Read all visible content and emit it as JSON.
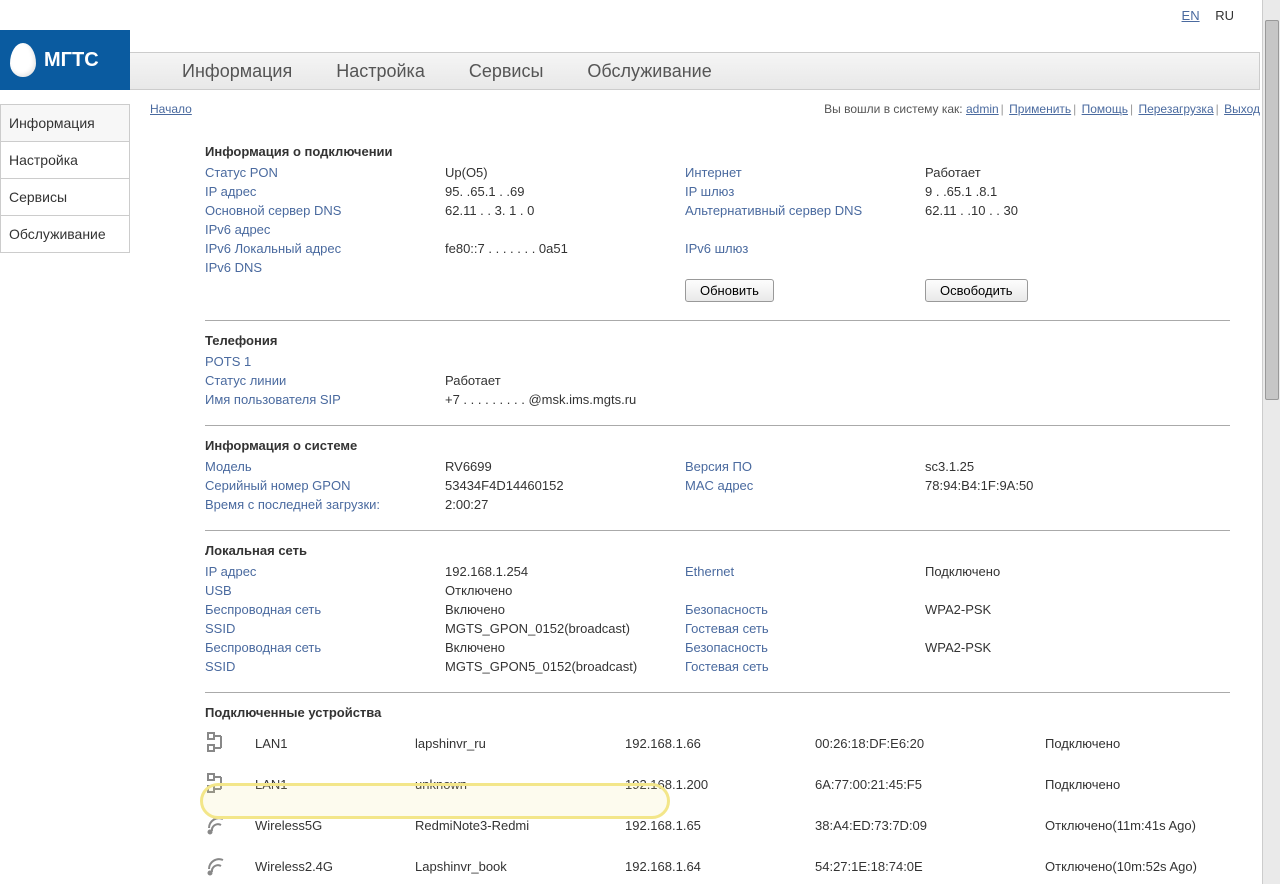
{
  "lang": {
    "en": "EN",
    "ru": "RU"
  },
  "logo": "МГТС",
  "topnav": [
    "Информация",
    "Настройка",
    "Сервисы",
    "Обслуживание"
  ],
  "sidenav": [
    "Информация",
    "Настройка",
    "Сервисы",
    "Обслуживание"
  ],
  "breadcrumb": "Начало",
  "login_prefix": "Вы вошли в систему как: ",
  "login_links": [
    "admin",
    "Применить",
    "Помощь",
    "Перезагрузка",
    "Выход"
  ],
  "section_connection": "Информация о подключении",
  "conn": {
    "pon_status_l": "Статус PON",
    "pon_status_v": "Up(O5)",
    "internet_l": "Интернет",
    "internet_v": "Работает",
    "ip_l": "IP адрес",
    "ip_v": "95. .65.1 . .69",
    "gw_l": "IP шлюз",
    "gw_v": "9 . .65.1 .8.1",
    "dns1_l": "Основной сервер DNS",
    "dns1_v": "62.11 . . 3. 1 . 0",
    "dns2_l": "Альтернативный сервер DNS",
    "dns2_v": "62.11 . .10 . . 30",
    "ipv6_l": "IPv6 адрес",
    "ipv6ll_l": "IPv6 Локальный адрес",
    "ipv6ll_v": "fe80::7 . . . . . . . 0a51",
    "ipv6gw_l": "IPv6 шлюз",
    "ipv6dns_l": "IPv6 DNS",
    "btn_refresh": "Обновить",
    "btn_release": "Освободить"
  },
  "section_phone": "Телефония",
  "phone": {
    "pots_l": "POTS 1",
    "line_l": "Статус линии",
    "line_v": "Работает",
    "sip_l": "Имя пользователя SIP",
    "sip_v": "+7 . . . . . . . . . @msk.ims.mgts.ru"
  },
  "section_sys": "Информация о системе",
  "sys": {
    "model_l": "Модель",
    "model_v": "RV6699",
    "fw_l": "Версия ПО",
    "fw_v": "sc3.1.25",
    "sn_l": "Серийный номер GPON",
    "sn_v": "53434F4D14460152",
    "mac_l": "MAC адрес",
    "mac_v": "78:94:B4:1F:9A:50",
    "uptime_l": "Время с последней загрузки:",
    "uptime_v": "2:00:27"
  },
  "section_lan": "Локальная сеть",
  "lan": {
    "ip_l": "IP адрес",
    "ip_v": "192.168.1.254",
    "eth_l": "Ethernet",
    "eth_v": "Подключено",
    "usb_l": "USB",
    "usb_v": "Отключено",
    "wl1_l": "Беспроводная сеть",
    "wl1_v": "Включено",
    "sec1_l": "Безопасность",
    "sec1_v": "WPA2-PSK",
    "ssid1_l": "SSID",
    "ssid1_v": "MGTS_GPON_0152(broadcast)",
    "guest1_l": "Гостевая сеть",
    "wl2_l": "Беспроводная сеть",
    "wl2_v": "Включено",
    "sec2_l": "Безопасность",
    "sec2_v": "WPA2-PSK",
    "ssid2_l": "SSID",
    "ssid2_v": "MGTS_GPON5_0152(broadcast)",
    "guest2_l": "Гостевая сеть"
  },
  "section_dev": "Подключенные устройства",
  "devices": [
    {
      "icon": "lan",
      "iface": "LAN1",
      "name": "lapshinvr_ru",
      "ip": "192.168.1.66",
      "mac": "00:26:18:DF:E6:20",
      "status": "Подключено"
    },
    {
      "icon": "lan",
      "iface": "LAN1",
      "name": "unknown",
      "ip": "192.168.1.200",
      "mac": "6A:77:00:21:45:F5",
      "status": "Подключено"
    },
    {
      "icon": "wifi",
      "iface": "Wireless5G",
      "name": "RedmiNote3-Redmi",
      "ip": "192.168.1.65",
      "mac": "38:A4:ED:73:7D:09",
      "status": "Отключено(11m:41s Ago)"
    },
    {
      "icon": "wifi",
      "iface": "Wireless2.4G",
      "name": "Lapshinvr_book",
      "ip": "192.168.1.64",
      "mac": "54:27:1E:18:74:0E",
      "status": "Отключено(10m:52s Ago)"
    }
  ]
}
